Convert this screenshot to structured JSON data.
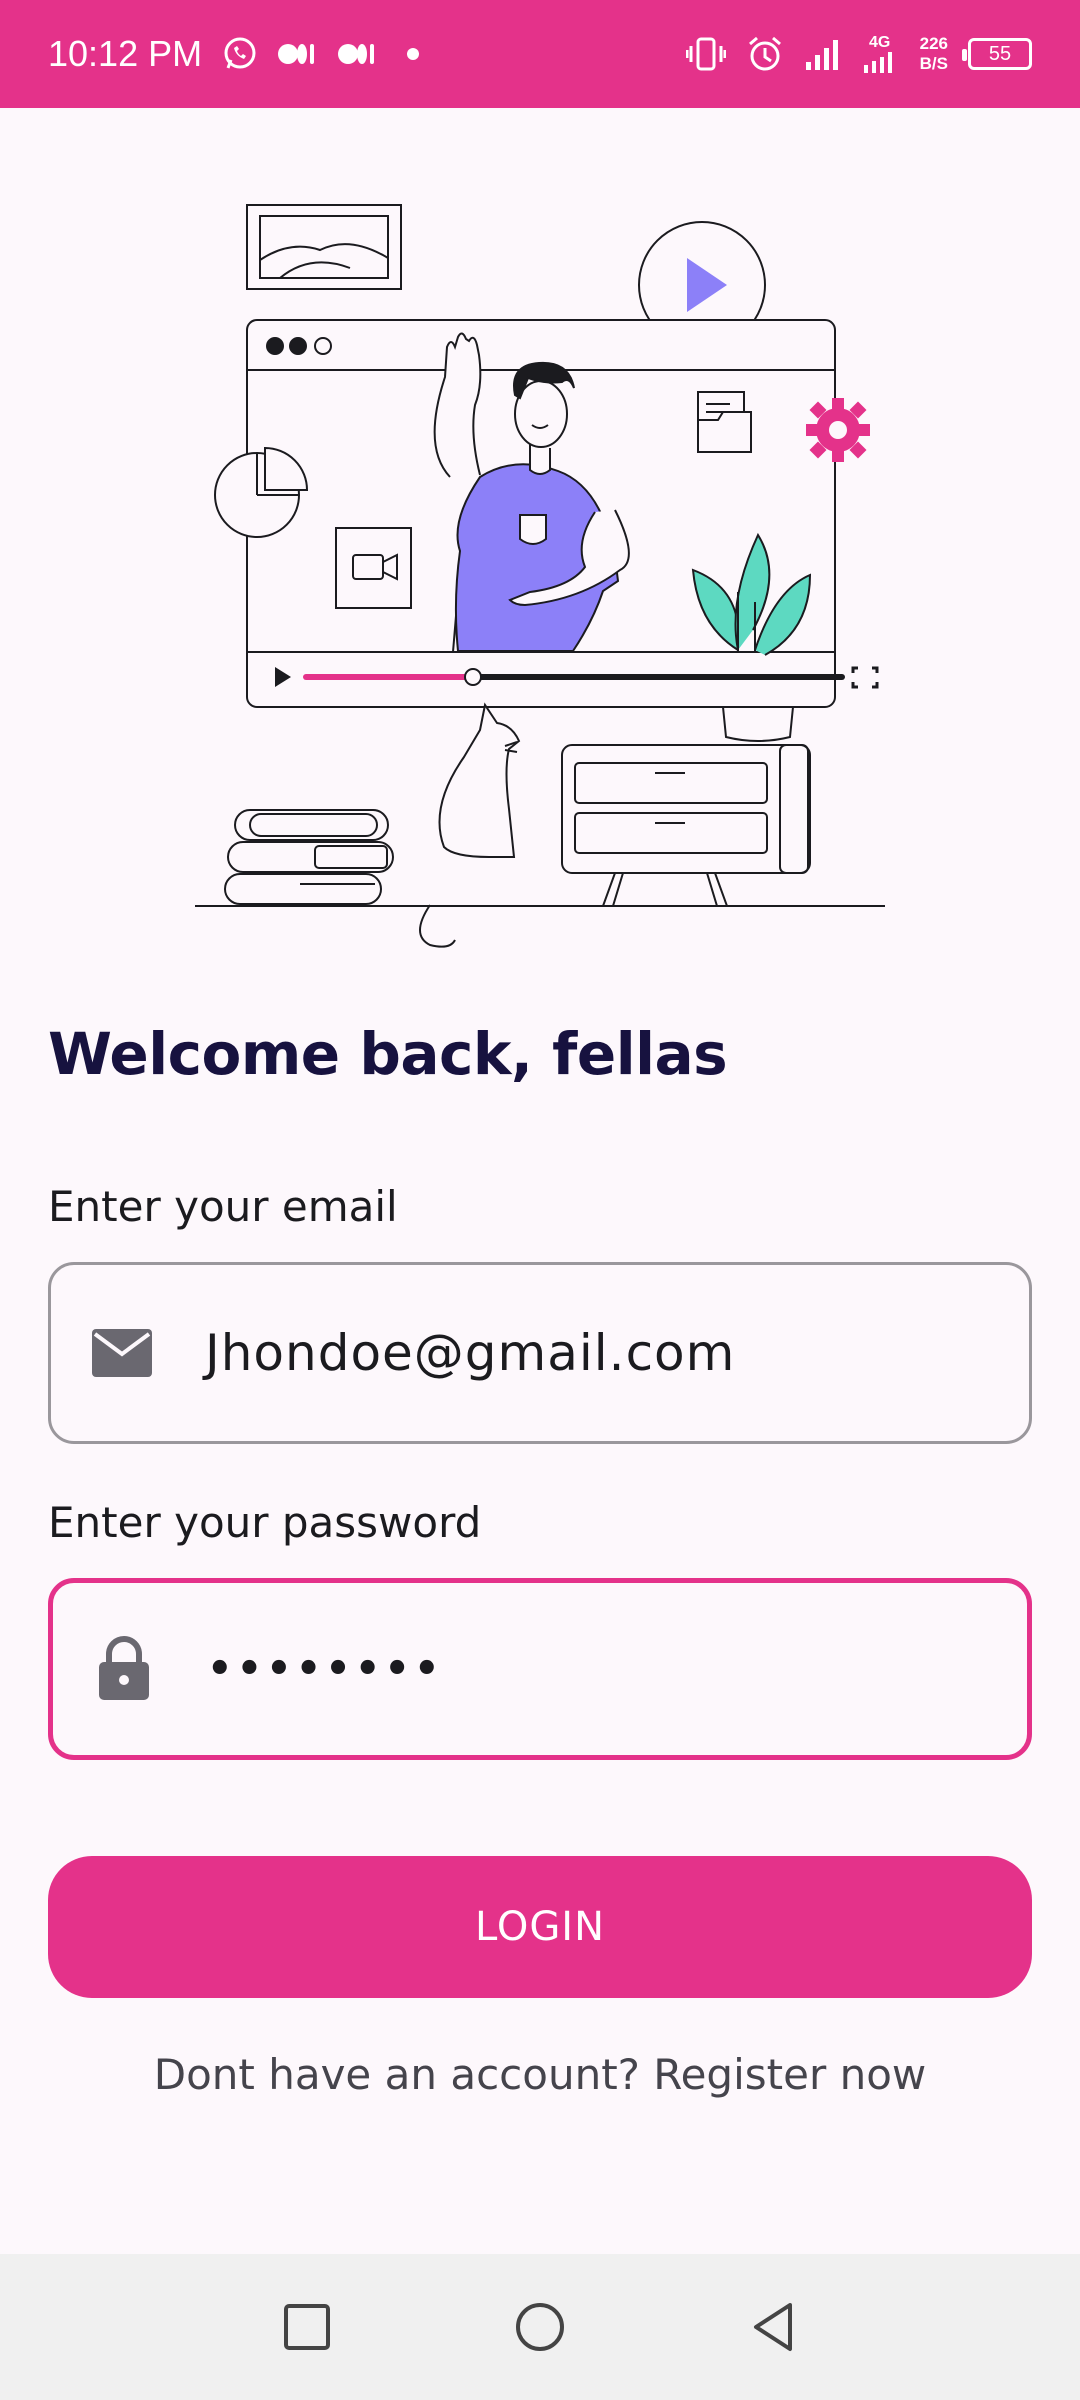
{
  "status_bar": {
    "time": "10:12 PM",
    "network_type": "4G",
    "speed_value": "226",
    "speed_unit": "B/S",
    "battery": "55",
    "icons": [
      "whatsapp-icon",
      "notification-icon",
      "notification-icon",
      "dot-icon",
      "vibrate-icon",
      "alarm-icon",
      "signal-icon",
      "signal-4g-icon"
    ]
  },
  "illustration": {
    "icon": "person-waving-video-illustration"
  },
  "welcome": {
    "title": "Welcome back, fellas"
  },
  "email": {
    "label": "Enter your email",
    "value": "Jhondoe@gmail.com",
    "icon": "mail-icon"
  },
  "password": {
    "label": "Enter your password",
    "value": "••••••••",
    "icon": "lock-icon"
  },
  "login": {
    "label": "LOGIN"
  },
  "register": {
    "text": "Dont have an account? Register now"
  },
  "nav_bar": {
    "icons": [
      "recents-square-icon",
      "home-circle-icon",
      "back-triangle-icon"
    ]
  },
  "colors": {
    "accent": "#e4328a",
    "title": "#17123f",
    "purple": "#8c80f8",
    "teal": "#5dd9c1"
  }
}
